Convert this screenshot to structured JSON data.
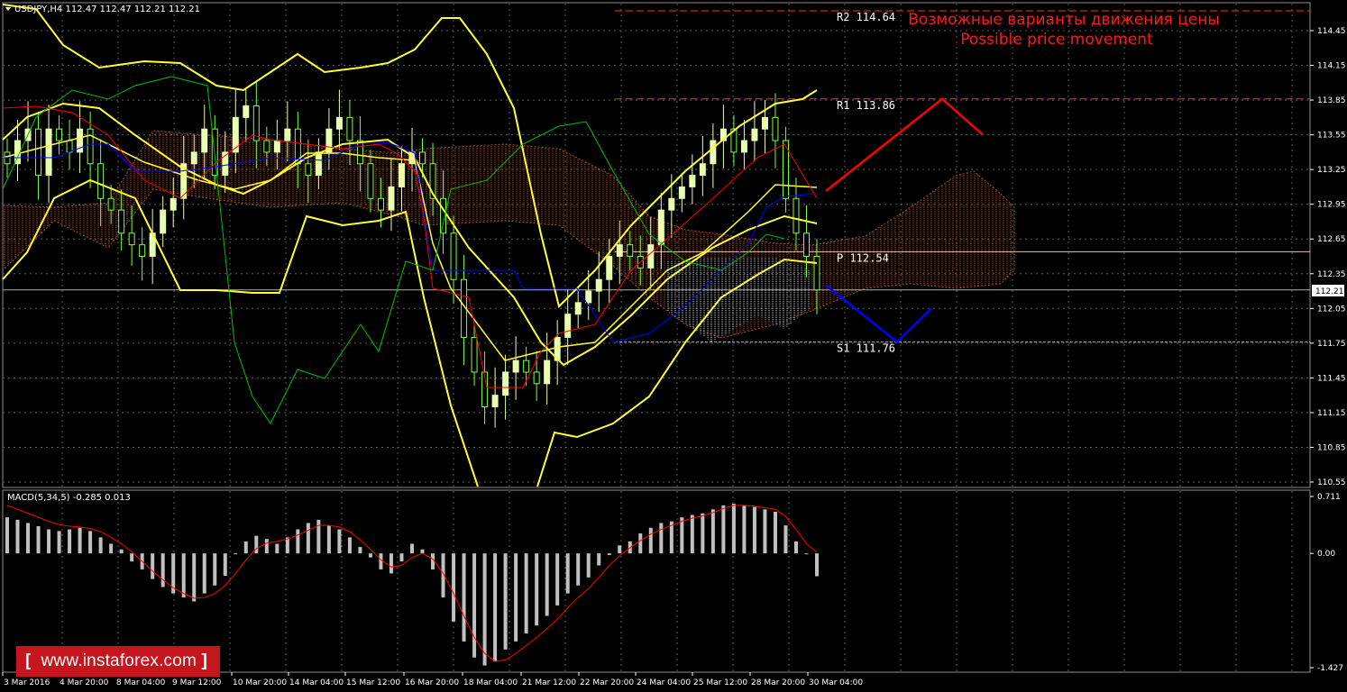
{
  "chart_info": "USDJPY,H4  112.47 112.47 112.21 112.21",
  "macd_info": "MACD(5,34,5) -0.285 0.013",
  "watermark": "www.instaforex.com",
  "annotation_ru": "Возможные варианты движения цены",
  "annotation_en": "Possible price movement",
  "current_price_label": "112.21",
  "colors": {
    "background": "#000000",
    "grid": "#5a5a5a",
    "bull_candle": "#e8ffb0",
    "bear_candle": "#7cff3a",
    "bollinger": "#ffff33",
    "tenkan": "#ff0000",
    "kijun": "#0000ff",
    "chikou": "#00c000",
    "cloud": "#a0522d",
    "macd_hist": "#c0c0c0",
    "macd_signal": "#ff0000",
    "bull_forecast": "#ff0000",
    "bear_forecast": "#0000ff",
    "resistance_line": "#ff3300",
    "pivot_line": "#ffcc33",
    "support_line": "#a0a0a0",
    "watermark_bg": "#c4161c"
  },
  "chart_data": {
    "type": "line",
    "symbol": "USDJPY",
    "timeframe": "H4",
    "ylim": [
      110.5,
      114.55
    ],
    "yticks": [
      "114.45",
      "114.15",
      "113.85",
      "113.55",
      "113.25",
      "112.95",
      "112.65",
      "112.35",
      "112.05",
      "111.75",
      "111.45",
      "111.15",
      "110.85",
      "110.55"
    ],
    "xticks": [
      "3 Mar 2016",
      "4 Mar 20:00",
      "8 Mar 04:00",
      "9 Mar 12:00",
      "10 Mar 20:00",
      "14 Mar 04:00",
      "15 Mar 12:00",
      "16 Mar 20:00",
      "18 Mar 04:00",
      "21 Mar 12:00",
      "22 Mar 20:00",
      "24 Mar 04:00",
      "25 Mar 12:00",
      "28 Mar 20:00",
      "30 Mar 04:00"
    ],
    "levels": [
      {
        "label": "R2",
        "value": 114.64,
        "text": "R2  114.64"
      },
      {
        "label": "R1",
        "value": 113.86,
        "text": "R1  113.86"
      },
      {
        "label": "P",
        "value": 112.54,
        "text": "P  112.54"
      },
      {
        "label": "S1",
        "value": 111.76,
        "text": "S1  111.76"
      }
    ],
    "current_price": 112.21,
    "forecast_up": [
      [
        0,
        113.05
      ],
      [
        1,
        113.86
      ],
      [
        2,
        113.55
      ]
    ],
    "forecast_down": [
      [
        0,
        112.25
      ],
      [
        1,
        111.76
      ],
      [
        2,
        112.05
      ]
    ],
    "close_series": [
      113.3,
      113.5,
      113.6,
      113.2,
      113.6,
      113.5,
      113.4,
      113.6,
      113.3,
      113.0,
      112.9,
      112.7,
      112.6,
      112.5,
      112.7,
      112.9,
      113.0,
      113.3,
      113.4,
      113.6,
      113.2,
      113.4,
      113.7,
      113.8,
      113.5,
      113.4,
      113.5,
      113.6,
      113.3,
      113.2,
      113.4,
      113.6,
      113.7,
      113.5,
      113.3,
      113.0,
      112.9,
      113.1,
      113.3,
      113.4,
      113.3,
      113.0,
      112.7,
      112.3,
      111.8,
      111.5,
      111.2,
      111.3,
      111.5,
      111.6,
      111.5,
      111.4,
      111.6,
      111.8,
      112.0,
      112.1,
      112.2,
      112.3,
      112.5,
      112.6,
      112.5,
      112.4,
      112.6,
      112.9,
      113.0,
      113.1,
      113.2,
      113.3,
      113.5,
      113.6,
      113.4,
      113.5,
      113.6,
      113.7,
      113.5,
      113.0,
      112.7,
      112.5,
      112.21
    ],
    "macd_ylim": [
      -1.427,
      0.711
    ],
    "macd_yticks": [
      "0.711",
      "0.00",
      "-1.427"
    ],
    "macd_hist": [
      0.45,
      0.42,
      0.38,
      0.34,
      0.3,
      0.28,
      0.3,
      0.32,
      0.28,
      0.2,
      0.12,
      0.05,
      -0.1,
      -0.2,
      -0.32,
      -0.42,
      -0.5,
      -0.55,
      -0.6,
      -0.5,
      -0.4,
      -0.28,
      0.0,
      0.15,
      0.22,
      0.18,
      0.12,
      0.2,
      0.3,
      0.38,
      0.42,
      0.35,
      0.3,
      0.2,
      0.08,
      -0.05,
      -0.2,
      -0.25,
      -0.1,
      0.12,
      0.05,
      -0.2,
      -0.55,
      -0.85,
      -1.1,
      -1.3,
      -1.4,
      -1.35,
      -1.2,
      -1.1,
      -1.0,
      -0.9,
      -0.78,
      -0.65,
      -0.5,
      -0.4,
      -0.3,
      -0.15,
      -0.02,
      0.1,
      0.15,
      0.25,
      0.32,
      0.38,
      0.4,
      0.45,
      0.48,
      0.5,
      0.55,
      0.6,
      0.62,
      0.6,
      0.58,
      0.55,
      0.52,
      0.35,
      0.15,
      0.0,
      -0.285
    ],
    "macd_signal": [
      0.6,
      0.55,
      0.5,
      0.45,
      0.4,
      0.36,
      0.34,
      0.33,
      0.31,
      0.27,
      0.2,
      0.12,
      0.02,
      -0.1,
      -0.22,
      -0.33,
      -0.43,
      -0.5,
      -0.56,
      -0.55,
      -0.5,
      -0.4,
      -0.25,
      -0.08,
      0.06,
      0.13,
      0.15,
      0.18,
      0.23,
      0.29,
      0.35,
      0.35,
      0.33,
      0.27,
      0.17,
      0.05,
      -0.08,
      -0.17,
      -0.15,
      -0.05,
      0.0,
      -0.07,
      -0.25,
      -0.5,
      -0.78,
      -1.05,
      -1.25,
      -1.35,
      -1.33,
      -1.25,
      -1.15,
      -1.05,
      -0.94,
      -0.82,
      -0.68,
      -0.55,
      -0.44,
      -0.3,
      -0.15,
      -0.03,
      0.07,
      0.16,
      0.24,
      0.3,
      0.35,
      0.4,
      0.44,
      0.47,
      0.51,
      0.56,
      0.6,
      0.6,
      0.59,
      0.57,
      0.55,
      0.46,
      0.3,
      0.12,
      0.013
    ]
  }
}
